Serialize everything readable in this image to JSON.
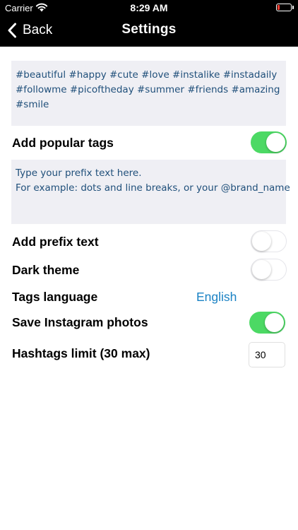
{
  "status_bar": {
    "carrier": "Carrier",
    "time": "8:29 AM",
    "wifi_icon": "wifi-icon",
    "battery_icon": "battery-low-icon"
  },
  "nav": {
    "back_label": "Back",
    "back_icon": "chevron-left-icon",
    "title": "Settings"
  },
  "popular_tags_text": "#beautiful #happy #cute #love #instalike #instadaily #followme #picoftheday #summer #friends #amazing #smile",
  "prefix_text_lines": [
    "Type your prefix text here.",
    "For example: dots and line breaks, or your @brand_name"
  ],
  "settings": {
    "add_popular_tags": {
      "label": "Add popular tags",
      "enabled": true
    },
    "add_prefix_text": {
      "label": "Add prefix text",
      "enabled": false
    },
    "dark_theme": {
      "label": "Dark theme",
      "enabled": false
    },
    "tags_language": {
      "label": "Tags language",
      "value": "English"
    },
    "save_instagram_photos": {
      "label": "Save Instagram photos",
      "enabled": true
    },
    "hashtags_limit": {
      "label": "Hashtags limit (30 max)",
      "value": "30"
    }
  },
  "colors": {
    "nav_background": "#000000",
    "toggle_on": "#4cd964",
    "link_blue": "#1a82c4",
    "text_area_background": "#efeff4",
    "tag_text": "#1f4f7a"
  }
}
